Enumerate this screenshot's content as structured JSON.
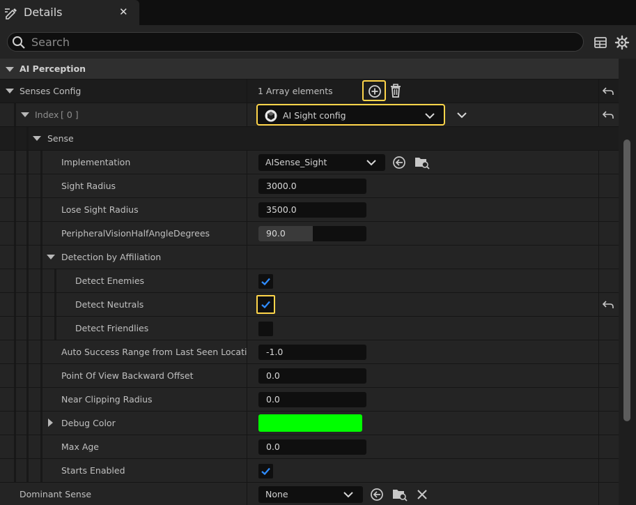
{
  "tab": {
    "title": "Details",
    "close": "✕"
  },
  "search": {
    "placeholder": "Search"
  },
  "category": {
    "title": "AI Perception"
  },
  "senses_config": {
    "label": "Senses Config",
    "value": "1 Array elements"
  },
  "index": {
    "label": "Index",
    "bracket": "[ 0 ]",
    "value": "AI Sight config"
  },
  "sense": {
    "label": "Sense"
  },
  "implementation": {
    "label": "Implementation",
    "value": "AISense_Sight"
  },
  "sight_radius": {
    "label": "Sight Radius",
    "value": "3000.0"
  },
  "lose_sight_radius": {
    "label": "Lose Sight Radius",
    "value": "3500.0"
  },
  "peripheral": {
    "label": "PeripheralVisionHalfAngleDegrees",
    "value": "90.0",
    "slider_fraction": 0.5
  },
  "detection": {
    "label": "Detection by Affiliation"
  },
  "detect_enemies": {
    "label": "Detect Enemies",
    "checked": true
  },
  "detect_neutrals": {
    "label": "Detect Neutrals",
    "checked": true
  },
  "detect_friendlies": {
    "label": "Detect Friendlies",
    "checked": false
  },
  "auto_success": {
    "label": "Auto Success Range from Last Seen Location",
    "value": "-1.0"
  },
  "pov_offset": {
    "label": "Point Of View Backward Offset",
    "value": "0.0"
  },
  "near_clipping": {
    "label": "Near Clipping Radius",
    "value": "0.0"
  },
  "debug_color": {
    "label": "Debug Color",
    "color": "#00ff00"
  },
  "max_age": {
    "label": "Max Age",
    "value": "0.0"
  },
  "starts_enabled": {
    "label": "Starts Enabled",
    "checked": true
  },
  "dominant_sense": {
    "label": "Dominant Sense",
    "value": "None"
  },
  "colors": {
    "highlight": "#ffd54a",
    "check": "#2f8cff",
    "debug": "#00ff00"
  }
}
